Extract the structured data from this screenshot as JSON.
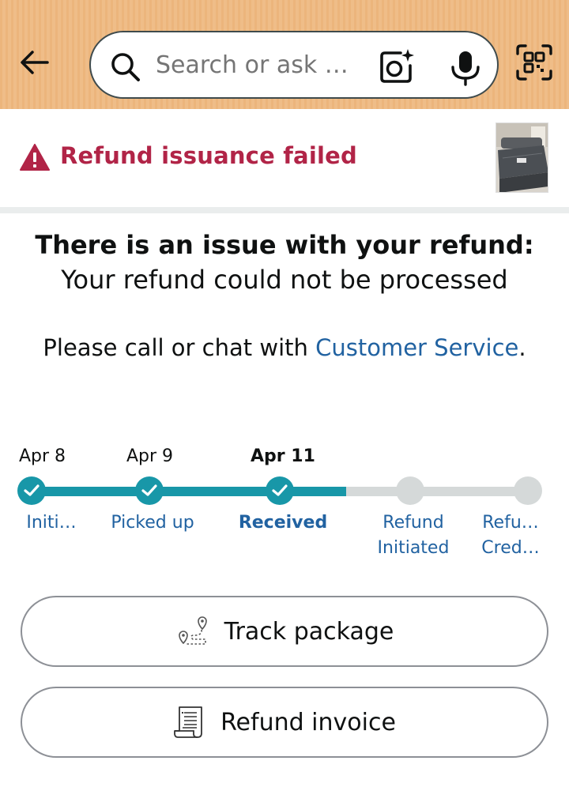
{
  "header": {
    "search_placeholder": "Search or ask a question",
    "icons": [
      "back-arrow-icon",
      "search-icon",
      "camera-lens-icon",
      "microphone-icon",
      "qr-scan-icon"
    ]
  },
  "alert": {
    "title": "Refund issuance failed",
    "color": "#b12447"
  },
  "message": {
    "headline_bold": "There is an issue with your refund:",
    "headline_rest": " Your refund could not be processed",
    "sub_prefix": "Please call or chat with ",
    "sub_link": "Customer Service",
    "sub_suffix": "."
  },
  "tracker": {
    "accent_color": "#1897a8",
    "dates": [
      "Apr 8",
      "Apr 9",
      "Apr 11"
    ],
    "steps": [
      {
        "label": "Initi…",
        "status": "done"
      },
      {
        "label": "Picked up",
        "status": "done"
      },
      {
        "label": "Received",
        "status": "current"
      },
      {
        "label_line1": "Refund",
        "label_line2": "Initiated",
        "status": "pending"
      },
      {
        "label_line1": "Refu…",
        "label_line2": "Cred…",
        "status": "pending"
      }
    ]
  },
  "buttons": {
    "track_package": "Track package",
    "refund_invoice": "Refund invoice"
  }
}
